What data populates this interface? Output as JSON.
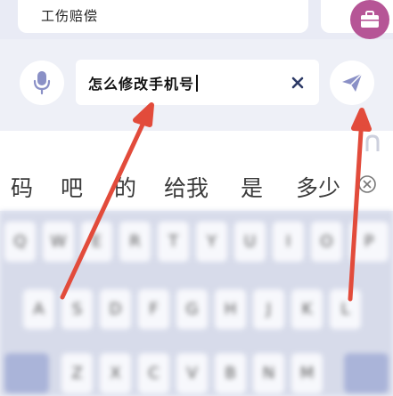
{
  "card": {
    "label": "工伤赔偿"
  },
  "search": {
    "value": "怎么修改手机号"
  },
  "candidates": [
    "码",
    "吧",
    "的",
    "给我",
    "是",
    "多少"
  ],
  "keyboard": {
    "row1": [
      "Q",
      "W",
      "E",
      "R",
      "T",
      "Y",
      "U",
      "I",
      "O",
      "P"
    ],
    "row2": [
      "A",
      "S",
      "D",
      "F",
      "G",
      "H",
      "J",
      "K",
      "L"
    ],
    "row3": [
      "Z",
      "X",
      "C",
      "V",
      "B",
      "N",
      "M"
    ]
  },
  "icons": {
    "badge": "briefcase-icon",
    "mic": "microphone-icon",
    "clear": "close-icon",
    "send": "paper-plane-icon",
    "candidate_close": "circle-close-icon"
  },
  "colors": {
    "accent": "#8a90c6",
    "badge": "#b65596",
    "annotation_arrow": "#e24b3b"
  }
}
